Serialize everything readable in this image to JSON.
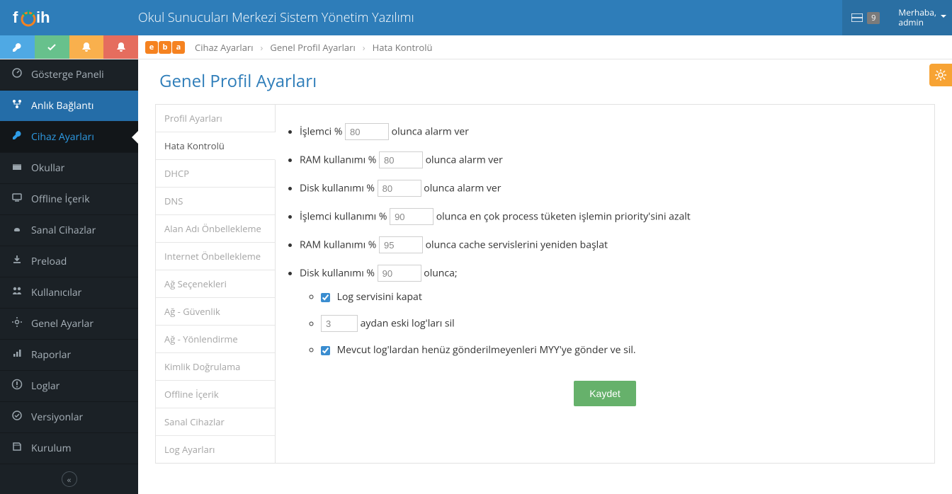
{
  "header": {
    "app_title": "Okul Sunucuları Merkezi Sistem Yönetim Yazılımı",
    "notification_count": "9",
    "greeting": "Merhaba,",
    "username": "admin"
  },
  "eba_logo": [
    "e",
    "b",
    "a"
  ],
  "breadcrumb": {
    "a": "Cihaz Ayarları",
    "b": "Genel Profil Ayarları",
    "c": "Hata Kontrolü"
  },
  "nav": [
    {
      "label": "Gösterge Paneli",
      "key": "dashboard"
    },
    {
      "label": "Anlık Bağlantı",
      "key": "live",
      "active_blue": true
    },
    {
      "label": "Cihaz Ayarları",
      "key": "device",
      "selected": true
    },
    {
      "label": "Okullar",
      "key": "schools"
    },
    {
      "label": "Offline İçerik",
      "key": "offline"
    },
    {
      "label": "Sanal Cihazlar",
      "key": "vm"
    },
    {
      "label": "Preload",
      "key": "preload"
    },
    {
      "label": "Kullanıcılar",
      "key": "users"
    },
    {
      "label": "Genel Ayarlar",
      "key": "settings"
    },
    {
      "label": "Raporlar",
      "key": "reports"
    },
    {
      "label": "Loglar",
      "key": "logs"
    },
    {
      "label": "Versiyonlar",
      "key": "versions"
    },
    {
      "label": "Kurulum",
      "key": "install"
    }
  ],
  "page": {
    "title": "Genel Profil Ayarları",
    "tabs": [
      "Profil Ayarları",
      "Hata Kontrolü",
      "DHCP",
      "DNS",
      "Alan Adı Önbellekleme",
      "Internet Önbellekleme",
      "Ağ Seçenekleri",
      "Ağ - Güvenlik",
      "Ağ - Yönlendirme",
      "Kimlik Doğrulama",
      "Offline İçerik",
      "Sanal Cihazlar",
      "Log Ayarları"
    ],
    "active_tab_index": 1,
    "save_label": "Kaydet"
  },
  "form": {
    "cpu_alarm": {
      "pre": "İşlemci %",
      "value": "80",
      "post": "olunca alarm ver"
    },
    "ram_alarm": {
      "pre": "RAM kullanımı %",
      "value": "80",
      "post": "olunca alarm ver"
    },
    "disk_alarm": {
      "pre": "Disk kullanımı %",
      "value": "80",
      "post": "olunca alarm ver"
    },
    "cpu_prio": {
      "pre": "İşlemci kullanımı %",
      "value": "90",
      "post": "olunca en çok process tüketen işlemin priority'sini azalt"
    },
    "ram_cache": {
      "pre": "RAM kullanımı %",
      "value": "95",
      "post": "olunca cache servislerini yeniden başlat"
    },
    "disk_when": {
      "pre": "Disk kullanımı %",
      "value": "90",
      "post": "olunca;"
    },
    "sub_log_close": {
      "checked": true,
      "label": "Log servisini kapat"
    },
    "sub_months": {
      "value": "3",
      "post": "aydan eski log'ları sil"
    },
    "sub_send": {
      "checked": true,
      "label": "Mevcut log'lardan henüz gönderilmeyenleri MYY'ye gönder ve sil."
    }
  }
}
